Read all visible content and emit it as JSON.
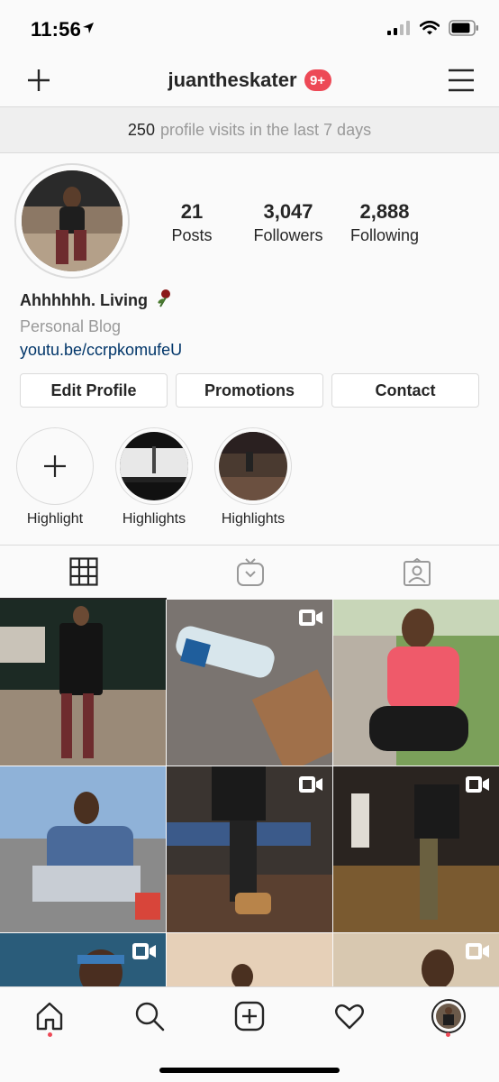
{
  "status": {
    "time": "11:56"
  },
  "nav": {
    "username": "juantheskater",
    "notification_badge": "9+"
  },
  "visits": {
    "count": "250",
    "text": "profile visits in the last 7 days"
  },
  "stats": [
    {
      "value": "21",
      "label": "Posts"
    },
    {
      "value": "3,047",
      "label": "Followers"
    },
    {
      "value": "2,888",
      "label": "Following"
    }
  ],
  "bio": {
    "name": "Ahhhhhh. Living",
    "category": "Personal Blog",
    "link": "youtu.be/ccrpkomufeU"
  },
  "buttons": {
    "edit": "Edit Profile",
    "promotions": "Promotions",
    "contact": "Contact"
  },
  "highlights": [
    {
      "label": "Highlight"
    },
    {
      "label": "Highlights"
    },
    {
      "label": "Highlights"
    }
  ],
  "tabs": [
    "grid-icon",
    "igtv-icon",
    "tagged-icon"
  ],
  "bottom_nav": [
    "home-icon",
    "search-icon",
    "new-post-icon",
    "activity-icon",
    "profile-avatar"
  ],
  "colors": {
    "badge": "#ed4956",
    "link": "#003569",
    "secondary_text": "#999999"
  }
}
